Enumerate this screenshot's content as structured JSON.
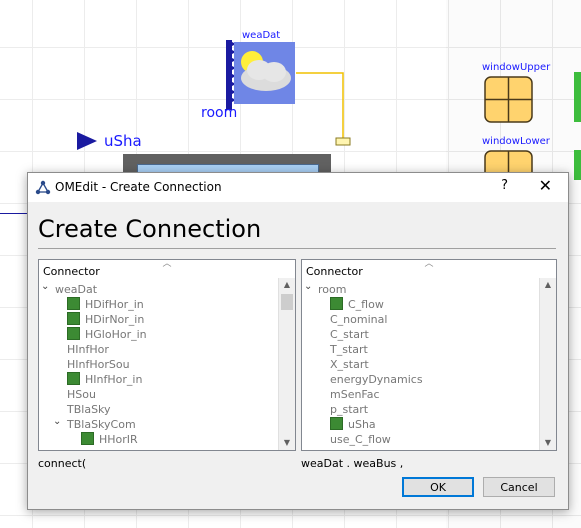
{
  "canvas": {
    "weaDat_label": "weaDat",
    "room_label": "room",
    "uSha_label": "uSha",
    "windowUpper_label": "windowUpper",
    "windowLower_label": "windowLower"
  },
  "dialog": {
    "window_title": "OMEdit - Create Connection",
    "help_label": "?",
    "close_label": "✕",
    "heading": "Create Connection",
    "left_tree": {
      "header": "Connector",
      "items": [
        {
          "label": "weaDat",
          "level": 0,
          "expander": "open",
          "icon": false
        },
        {
          "label": "HDifHor_in",
          "level": 1,
          "icon": true
        },
        {
          "label": "HDirNor_in",
          "level": 1,
          "icon": true
        },
        {
          "label": "HGloHor_in",
          "level": 1,
          "icon": true
        },
        {
          "label": "HInfHor",
          "level": 1,
          "icon": false
        },
        {
          "label": "HInfHorSou",
          "level": 1,
          "icon": false
        },
        {
          "label": "HInfHor_in",
          "level": 1,
          "icon": true
        },
        {
          "label": "HSou",
          "level": 1,
          "icon": false
        },
        {
          "label": "TBlaSky",
          "level": 1,
          "icon": false
        },
        {
          "label": "TBlaSkyCom",
          "level": 1,
          "expander": "open",
          "icon": false
        },
        {
          "label": "HHorIR",
          "level": 2,
          "icon": true
        }
      ]
    },
    "right_tree": {
      "header": "Connector",
      "items": [
        {
          "label": "room",
          "level": 0,
          "expander": "open",
          "icon": false
        },
        {
          "label": "C_flow",
          "level": 1,
          "icon": true
        },
        {
          "label": "C_nominal",
          "level": 1,
          "icon": false
        },
        {
          "label": "C_start",
          "level": 1,
          "icon": false
        },
        {
          "label": "T_start",
          "level": 1,
          "icon": false
        },
        {
          "label": "X_start",
          "level": 1,
          "icon": false
        },
        {
          "label": "energyDynamics",
          "level": 1,
          "icon": false
        },
        {
          "label": "mSenFac",
          "level": 1,
          "icon": false
        },
        {
          "label": "p_start",
          "level": 1,
          "icon": false
        },
        {
          "label": "uSha",
          "level": 1,
          "icon": true
        },
        {
          "label": "use_C_flow",
          "level": 1,
          "icon": false
        }
      ]
    },
    "connect_prefix": "connect(",
    "connect_args": "weaDat . weaBus ,",
    "ok_label": "OK",
    "cancel_label": "Cancel"
  }
}
